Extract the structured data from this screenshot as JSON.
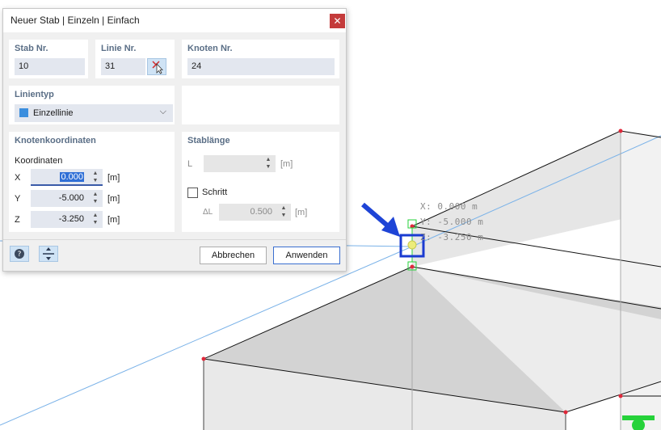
{
  "dialog": {
    "title": "Neuer Stab | Einzeln | Einfach",
    "stab_nr": {
      "label": "Stab Nr.",
      "value": "10"
    },
    "linie_nr": {
      "label": "Linie Nr.",
      "value": "31"
    },
    "knoten_nr": {
      "label": "Knoten Nr.",
      "value": "24"
    },
    "linientyp": {
      "label": "Linientyp",
      "selected": "Einzellinie",
      "swatch_color": "#3b8ede"
    },
    "knotenkoordinaten": {
      "label": "Knotenkoordinaten",
      "sub_label": "Koordinaten",
      "x": {
        "label": "X",
        "value": "0.000",
        "unit": "[m]"
      },
      "y": {
        "label": "Y",
        "value": "-5.000",
        "unit": "[m]"
      },
      "z": {
        "label": "Z",
        "value": "-3.250",
        "unit": "[m]"
      }
    },
    "stablaenge": {
      "label": "Stablänge",
      "l": {
        "label": "L",
        "value": "",
        "unit": "[m]"
      },
      "schritt": {
        "label": "Schritt",
        "checked": false
      },
      "delta_l": {
        "label": "ΔL",
        "value": "0.500",
        "unit": "[m]"
      }
    },
    "buttons": {
      "cancel": "Abbrechen",
      "apply": "Anwenden"
    }
  },
  "viewport": {
    "coord_readout": [
      "X: 0.000 m",
      "Y: -5.000 m",
      "Z: -3.250 m"
    ],
    "colors": {
      "highlight": "#1a3bd1",
      "node": "#e0283a",
      "support": "#26d23a",
      "axis_line": "#7ab2e8",
      "arrow": "#1e44d6"
    }
  }
}
